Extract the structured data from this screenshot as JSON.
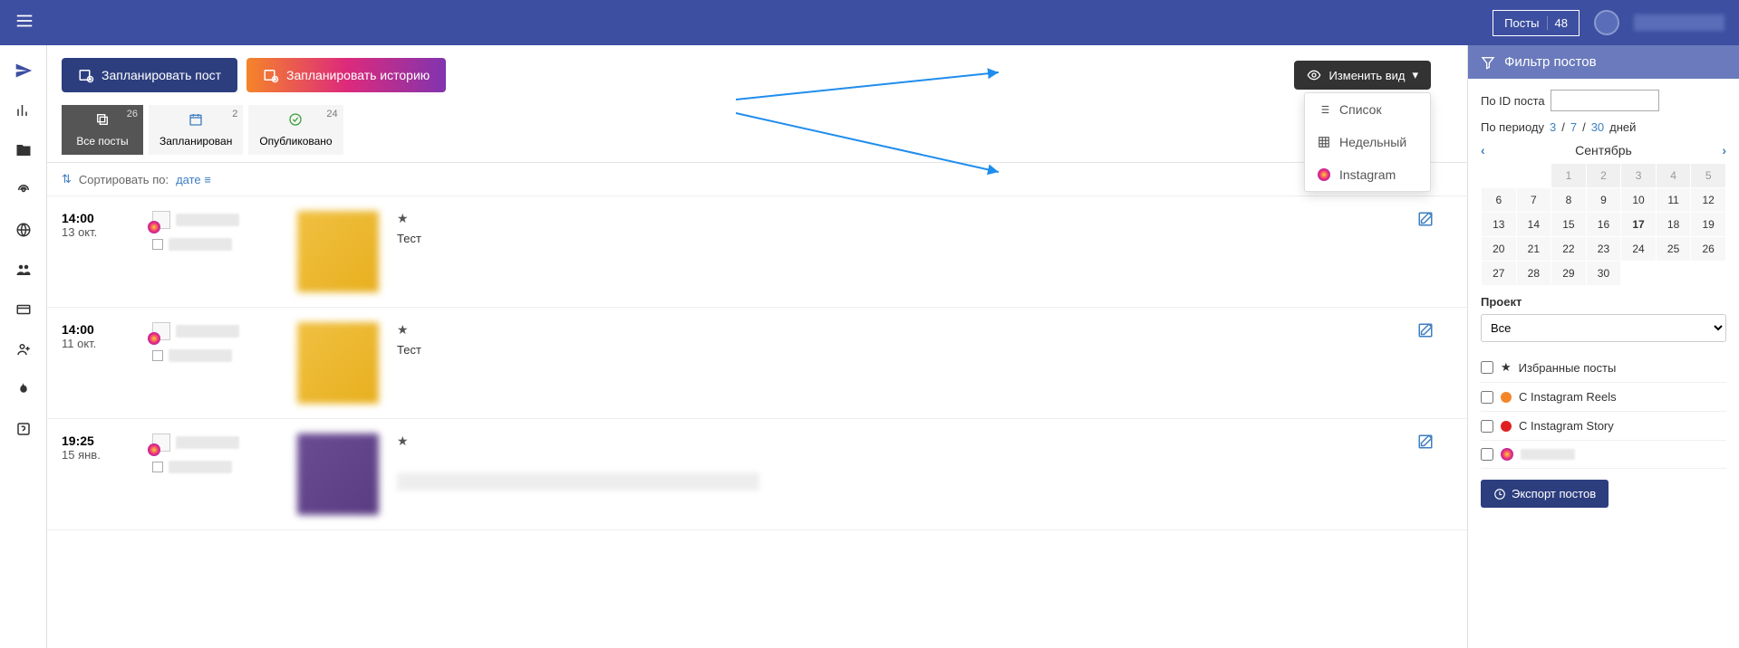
{
  "topbar": {
    "posts_label": "Посты",
    "posts_count": "48"
  },
  "actions": {
    "schedule_post": "Запланировать пост",
    "schedule_story": "Запланировать историю",
    "change_view": "Изменить вид"
  },
  "view_dropdown": {
    "list": "Список",
    "weekly": "Недельный",
    "instagram": "Instagram"
  },
  "tabs": [
    {
      "label": "Все посты",
      "count": "26",
      "icon": "copy"
    },
    {
      "label": "Запланирован",
      "count": "2",
      "icon": "calendar"
    },
    {
      "label": "Опубликовано",
      "count": "24",
      "icon": "check"
    }
  ],
  "sort": {
    "label": "Сортировать по:",
    "value": "дате"
  },
  "posts": [
    {
      "time": "14:00",
      "date": "13 окт.",
      "star": "★",
      "text": "Тест",
      "media": "yellow"
    },
    {
      "time": "14:00",
      "date": "11 окт.",
      "star": "★",
      "text": "Тест",
      "media": "yellow"
    },
    {
      "time": "19:25",
      "date": "15 янв.",
      "star": "★",
      "text": "",
      "media": "purple"
    }
  ],
  "filter": {
    "title": "Фильтр постов",
    "by_id_label": "По ID поста",
    "by_period_label": "По периоду",
    "period_days": "дней",
    "period_options": [
      "3",
      "7",
      "30"
    ],
    "project_label": "Проект",
    "project_value": "Все",
    "fav_label": "Избранные посты",
    "reels_label": "С Instagram Reels",
    "story_label": "С Instagram Story",
    "export_label": "Экспорт постов"
  },
  "calendar": {
    "month": "Сентябрь",
    "today": 17,
    "rows": [
      [
        null,
        null,
        1,
        2,
        3,
        4,
        5
      ],
      [
        6,
        7,
        8,
        9,
        10,
        11,
        12
      ],
      [
        13,
        14,
        15,
        16,
        17,
        18,
        19
      ],
      [
        20,
        21,
        22,
        23,
        24,
        25,
        26
      ],
      [
        27,
        28,
        29,
        30,
        null,
        null,
        null
      ]
    ]
  }
}
